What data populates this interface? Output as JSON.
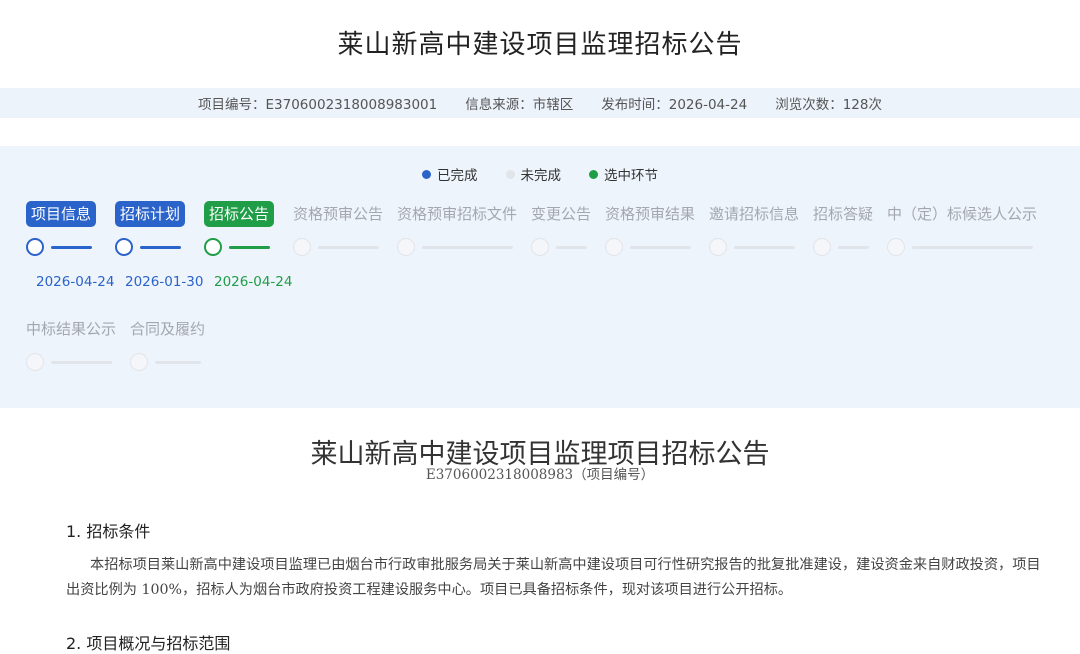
{
  "page_title": "莱山新高中建设项目监理招标公告",
  "meta": {
    "project_no": "项目编号：E3706002318008983001",
    "source": "信息来源：市辖区",
    "publish_time": "发布时间：2026-04-24",
    "views": "浏览次数：128次"
  },
  "legend": {
    "completed": "已完成",
    "incomplete": "未完成",
    "selected": "选中环节"
  },
  "colors": {
    "completed": "#2a63c9",
    "incomplete": "#e1e4e9",
    "selected": "#1f9d47"
  },
  "stages": [
    {
      "label": "项目信息",
      "status": "done",
      "date": "2026-04-24"
    },
    {
      "label": "招标计划",
      "status": "done",
      "date": "2026-01-30"
    },
    {
      "label": "招标公告",
      "status": "current",
      "date": "2026-04-24"
    },
    {
      "label": "资格预审公告",
      "status": "todo",
      "date": ""
    },
    {
      "label": "资格预审招标文件",
      "status": "todo",
      "date": ""
    },
    {
      "label": "变更公告",
      "status": "todo",
      "date": ""
    },
    {
      "label": "资格预审结果",
      "status": "todo",
      "date": ""
    },
    {
      "label": "邀请招标信息",
      "status": "todo",
      "date": ""
    },
    {
      "label": "招标答疑",
      "status": "todo",
      "date": ""
    },
    {
      "label": "中（定）标候选人公示",
      "status": "todo",
      "date": ""
    },
    {
      "label": "中标结果公示",
      "status": "todo",
      "date": ""
    },
    {
      "label": "合同及履约",
      "status": "todo",
      "date": ""
    }
  ],
  "document": {
    "title": "莱山新高中建设项目监理项目招标公告",
    "subtitle": "E3706002318008983（项目编号）",
    "section1_heading": "1. 招标条件",
    "section1_text": "本招标项目莱山新高中建设项目监理已由烟台市行政审批服务局关于莱山新高中建设项目可行性研究报告的批复批准建设，建设资金来自财政投资，项目出资比例为 100%，招标人为烟台市政府投资工程建设服务中心。项目已具备招标条件，现对该项目进行公开招标。",
    "section2_heading": "2. 项目概况与招标范围"
  }
}
